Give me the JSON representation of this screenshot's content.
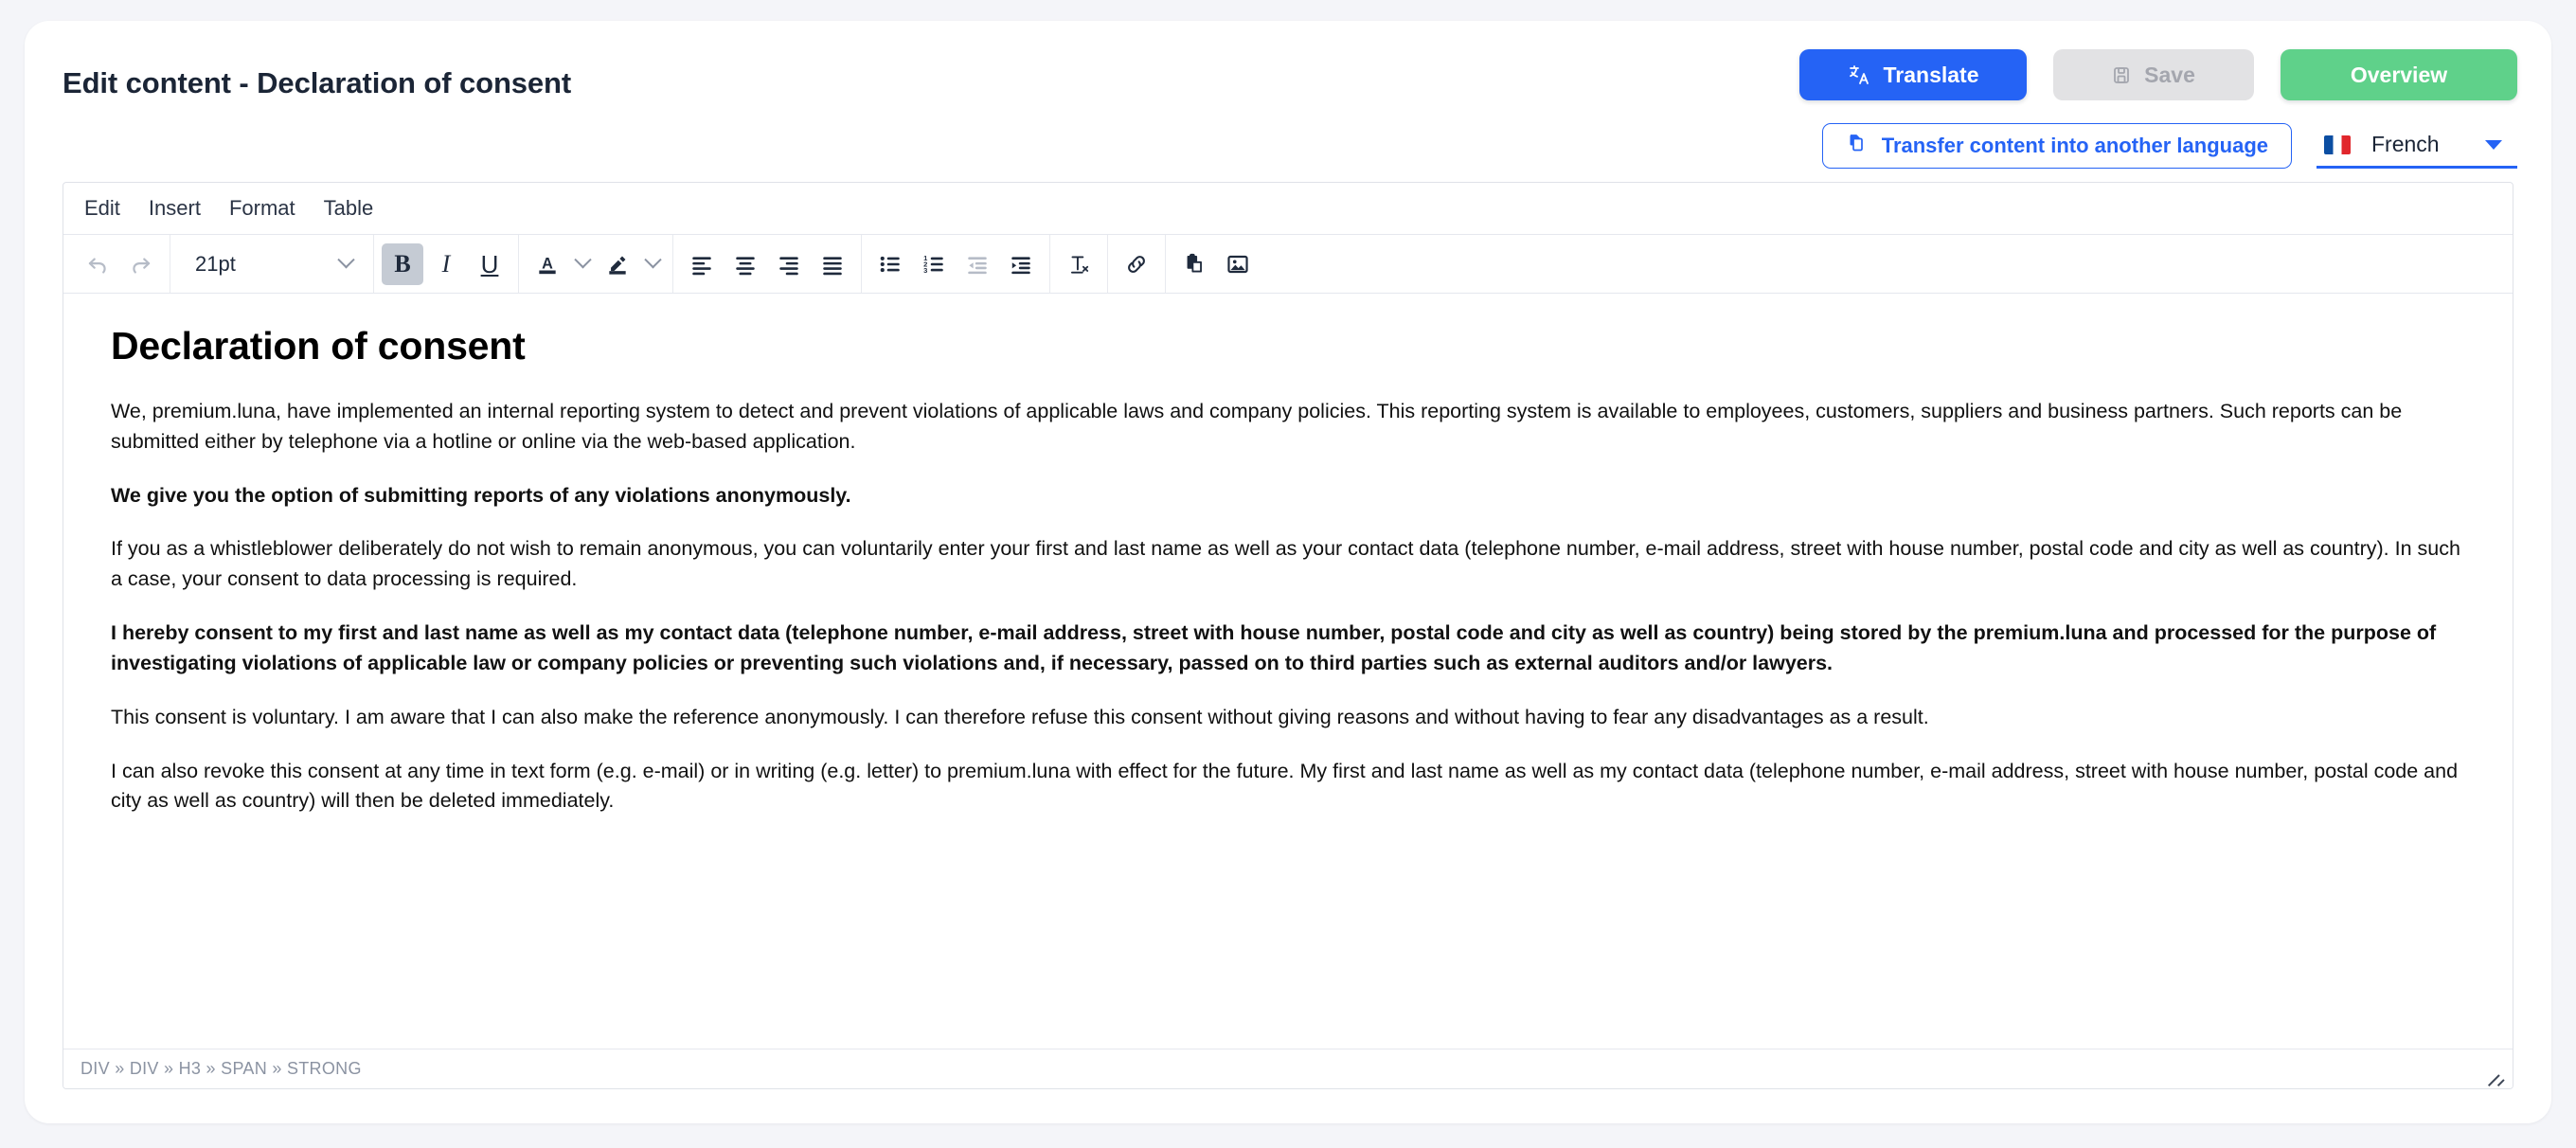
{
  "header": {
    "title": "Edit content - Declaration of consent",
    "buttons": {
      "translate": "Translate",
      "save": "Save",
      "overview": "Overview"
    },
    "transfer_button": "Transfer content into another language",
    "language": {
      "selected": "French",
      "flag": "fr-flag-icon"
    }
  },
  "editor": {
    "menubar": [
      {
        "label": "Edit"
      },
      {
        "label": "Insert"
      },
      {
        "label": "Format"
      },
      {
        "label": "Table"
      }
    ],
    "toolbar": {
      "font_size": "21pt",
      "buttons": [
        {
          "name": "undo",
          "state": "disabled"
        },
        {
          "name": "redo",
          "state": "disabled"
        },
        {
          "name": "bold",
          "state": "active"
        },
        {
          "name": "italic",
          "state": "normal"
        },
        {
          "name": "underline",
          "state": "normal"
        },
        {
          "name": "text-color",
          "state": "normal"
        },
        {
          "name": "highlight-color",
          "state": "normal"
        },
        {
          "name": "align-left",
          "state": "normal"
        },
        {
          "name": "align-center",
          "state": "normal"
        },
        {
          "name": "align-right",
          "state": "normal"
        },
        {
          "name": "align-justify",
          "state": "normal"
        },
        {
          "name": "bullet-list",
          "state": "normal"
        },
        {
          "name": "numbered-list",
          "state": "normal"
        },
        {
          "name": "outdent",
          "state": "disabled"
        },
        {
          "name": "indent",
          "state": "normal"
        },
        {
          "name": "clear-formatting",
          "state": "normal"
        },
        {
          "name": "insert-link",
          "state": "normal"
        },
        {
          "name": "paste",
          "state": "normal"
        },
        {
          "name": "insert-image",
          "state": "normal"
        }
      ]
    },
    "document": {
      "heading": "Declaration of consent",
      "paragraphs": [
        {
          "bold": false,
          "text": "We, premium.luna, have implemented an internal reporting system to detect and prevent violations of applicable laws and company policies. This reporting system is available to employees, customers, suppliers and business partners. Such reports can be submitted either by telephone via a hotline or online via the web-based application."
        },
        {
          "bold": true,
          "text": "We give you the option of submitting reports of any violations anonymously."
        },
        {
          "bold": false,
          "text": "If you as a whistleblower deliberately do not wish to remain anonymous, you can voluntarily enter your first and last name as well as your contact data (telephone number, e-mail address, street with house number, postal code and city as well as country). In such a case, your consent to data processing is required."
        },
        {
          "bold": true,
          "text": "I hereby consent to my first and last name as well as my contact data (telephone number, e-mail address, street with house number, postal code and city as well as country) being stored by the premium.luna and processed for the purpose of investigating violations of applicable law or company policies or preventing such violations and, if necessary, passed on to third parties such as external auditors and/or lawyers."
        },
        {
          "bold": false,
          "text": "This consent is voluntary. I am aware that I can also make the reference anonymously. I can therefore refuse this consent without giving reasons and without having to fear any disadvantages as a result."
        },
        {
          "bold": false,
          "text": "I can also revoke this consent at any time in text form (e.g. e-mail) or in writing (e.g. letter) to premium.luna with effect for the future. My first and last name as well as my contact data (telephone number, e-mail address, street with house number, postal code and city as well as country) will then be deleted immediately."
        }
      ]
    },
    "statusbar": {
      "element_path": "DIV » DIV » H3 » SPAN » STRONG"
    }
  },
  "colors": {
    "primary_blue": "#2563f5",
    "success_green": "#5fd18a",
    "disabled_gray": "#e2e2e4",
    "page_background": "#f4f5f9"
  }
}
